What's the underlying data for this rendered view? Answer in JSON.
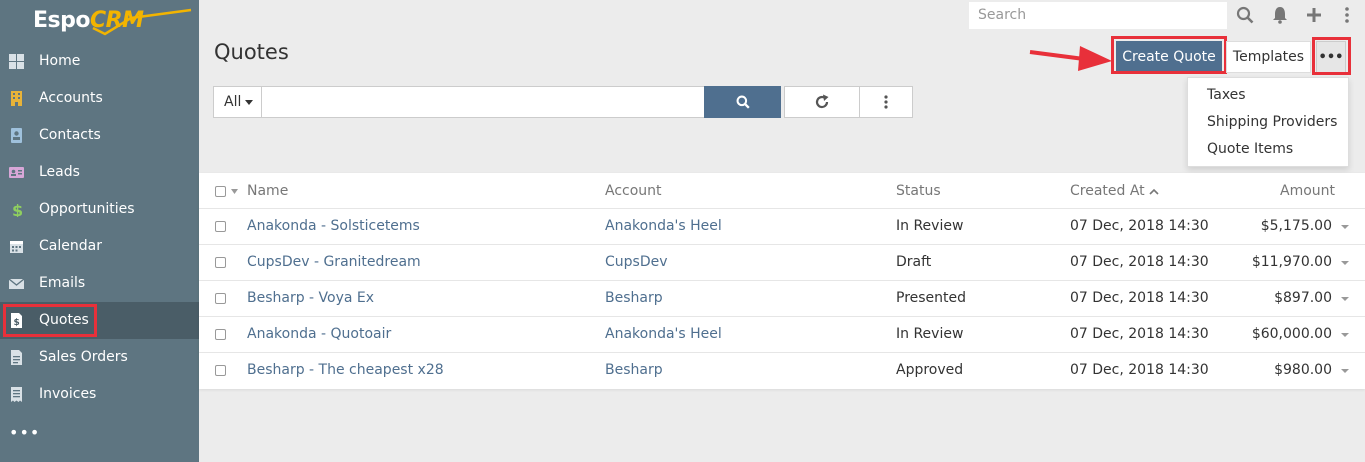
{
  "app": {
    "logo_part1": "Espo",
    "logo_part2": "CRM",
    "accent": "#f2b400",
    "primary": "#4f6f8f",
    "highlight": "#e8303a"
  },
  "sidebar": {
    "items": [
      {
        "label": "Home",
        "icon": "home-icon"
      },
      {
        "label": "Accounts",
        "icon": "building-icon"
      },
      {
        "label": "Contacts",
        "icon": "contact-icon"
      },
      {
        "label": "Leads",
        "icon": "id-card-icon"
      },
      {
        "label": "Opportunities",
        "icon": "dollar-icon"
      },
      {
        "label": "Calendar",
        "icon": "calendar-icon"
      },
      {
        "label": "Emails",
        "icon": "envelope-icon"
      },
      {
        "label": "Quotes",
        "icon": "file-dollar-icon"
      },
      {
        "label": "Sales Orders",
        "icon": "file-icon"
      },
      {
        "label": "Invoices",
        "icon": "receipt-icon"
      }
    ],
    "more": "•••"
  },
  "topbar": {
    "search_placeholder": "Search"
  },
  "header": {
    "title": "Quotes",
    "create_label": "Create Quote",
    "templates_label": "Templates",
    "more_label": "•••"
  },
  "dropdown": {
    "items": [
      "Taxes",
      "Shipping Providers",
      "Quote Items"
    ]
  },
  "filter": {
    "all_label": "All"
  },
  "table": {
    "columns": [
      "Name",
      "Account",
      "Status",
      "Created At",
      "Amount"
    ],
    "rows": [
      {
        "name": "Anakonda - Solsticetems",
        "account": "Anakonda's Heel",
        "status": "In Review",
        "created": "07 Dec, 2018 14:30",
        "amount": "$5,175.00"
      },
      {
        "name": "CupsDev - Granitedream",
        "account": "CupsDev",
        "status": "Draft",
        "created": "07 Dec, 2018 14:30",
        "amount": "$11,970.00"
      },
      {
        "name": "Besharp - Voya Ex",
        "account": "Besharp",
        "status": "Presented",
        "created": "07 Dec, 2018 14:30",
        "amount": "$897.00"
      },
      {
        "name": "Anakonda - Quotoair",
        "account": "Anakonda's Heel",
        "status": "In Review",
        "created": "07 Dec, 2018 14:30",
        "amount": "$60,000.00"
      },
      {
        "name": "Besharp - The cheapest x28",
        "account": "Besharp",
        "status": "Approved",
        "created": "07 Dec, 2018 14:30",
        "amount": "$980.00"
      }
    ]
  }
}
